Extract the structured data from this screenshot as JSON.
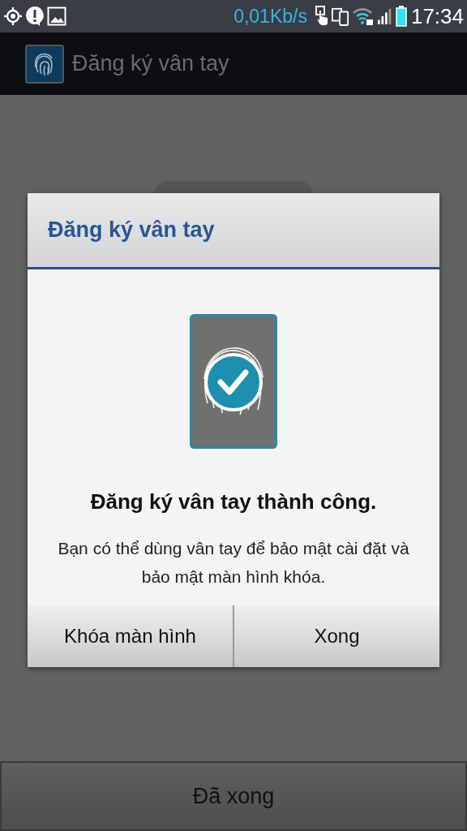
{
  "status_bar": {
    "speed": "0,01Kb/s",
    "time": "17:34"
  },
  "action_bar": {
    "title": "Đăng ký vân tay"
  },
  "background": {
    "done_button": "Đã xong"
  },
  "dialog": {
    "title": "Đăng ký vân tay",
    "heading": "Đăng ký vân tay thành công.",
    "message": "Bạn có thể dùng vân tay  để bảo mật cài  đặt và bảo mật màn hình khóa.",
    "buttons": [
      "Khóa màn hình",
      "Xong"
    ]
  }
}
